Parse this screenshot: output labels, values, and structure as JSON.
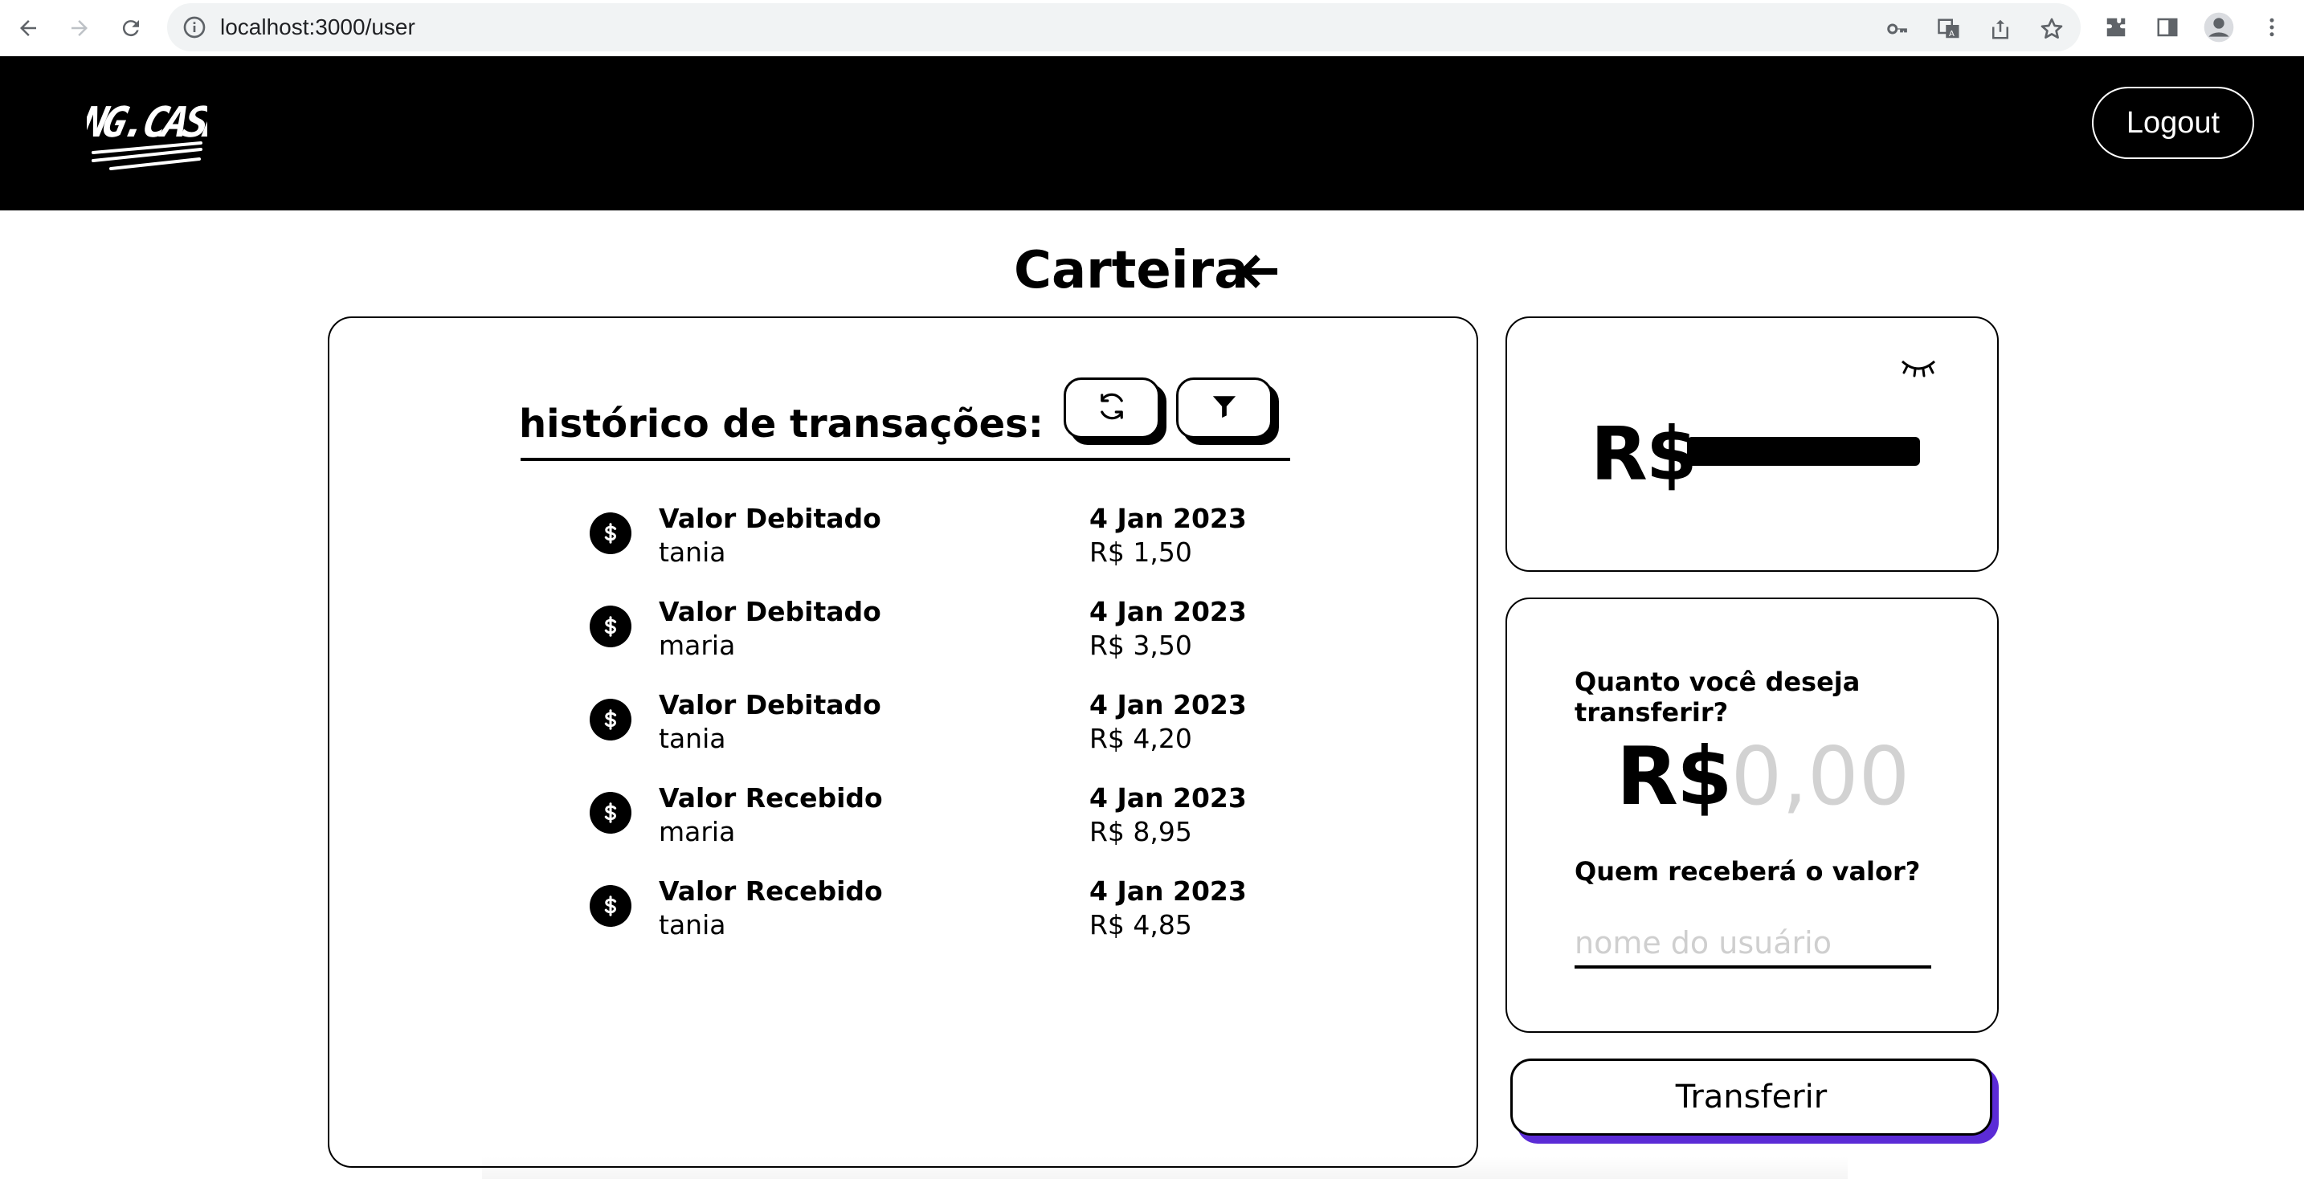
{
  "browser": {
    "url": "localhost:3000/user"
  },
  "header": {
    "logo_text": "NG.CASH",
    "logout_label": "Logout"
  },
  "page": {
    "title": "Carteira"
  },
  "history": {
    "title": "histórico de transações:",
    "transactions": [
      {
        "type": "Valor Debitado",
        "user": "tania",
        "date": "4 Jan 2023",
        "amount": "R$ 1,50"
      },
      {
        "type": "Valor Debitado",
        "user": "maria",
        "date": "4 Jan 2023",
        "amount": "R$ 3,50"
      },
      {
        "type": "Valor Debitado",
        "user": "tania",
        "date": "4 Jan 2023",
        "amount": "R$ 4,20"
      },
      {
        "type": "Valor Recebido",
        "user": "maria",
        "date": "4 Jan 2023",
        "amount": "R$ 8,95"
      },
      {
        "type": "Valor Recebido",
        "user": "tania",
        "date": "4 Jan 2023",
        "amount": "R$ 4,85"
      }
    ]
  },
  "balance": {
    "currency": "R$",
    "hidden": true
  },
  "transfer": {
    "amount_question": "Quanto você deseja transferir?",
    "currency": "R$",
    "amount_placeholder": "0,00",
    "recipient_question": "Quem receberá o valor?",
    "recipient_placeholder": "nome do usuário",
    "submit_label": "Transferir"
  },
  "colors": {
    "header_bg": "#000000",
    "accent_shadow": "#5b2bd6",
    "placeholder": "#d2d2d2"
  }
}
